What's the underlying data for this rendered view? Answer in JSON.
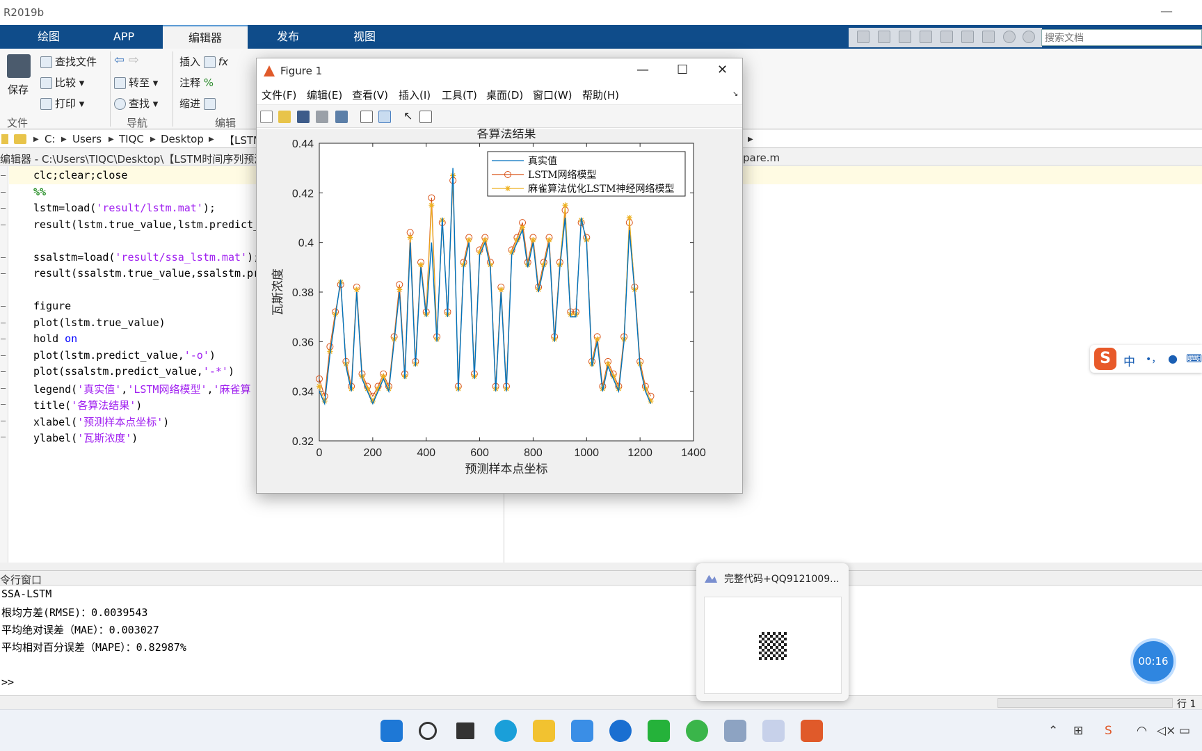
{
  "app": {
    "title": "R2019b",
    "minimize": "—"
  },
  "tabs": [
    "绘图",
    "APP",
    "编辑器",
    "发布",
    "视图"
  ],
  "search": {
    "placeholder": "搜索文档"
  },
  "ribbon": {
    "file": {
      "save": "保存",
      "find_files": "查找文件",
      "compare": "比较",
      "print": "打印",
      "section": "文件"
    },
    "nav": {
      "goto": "转至",
      "find": "查找",
      "section": "导航"
    },
    "edit": {
      "insert": "插入",
      "comment": "注释",
      "indent": "缩进",
      "fx": "fx",
      "section": "编辑"
    }
  },
  "breadcrumb": {
    "items": [
      "C:",
      "Users",
      "TIQC",
      "Desktop",
      "【LSTM"
    ]
  },
  "editor_header": {
    "path": "编辑器 - C:\\Users\\TIQC\\Desktop\\【LSTM时间序列预测",
    "tab2": "pare.m"
  },
  "code": [
    "clc;clear;close",
    "%%",
    "lstm=load('result/lstm.mat');",
    "result(lstm.true_value,lstm.predict_",
    "",
    "ssalstm=load('result/ssa_lstm.mat');",
    "result(ssalstm.true_value,ssalstm.pr",
    "",
    "figure",
    "plot(lstm.true_value)",
    "hold on",
    "plot(lstm.predict_value,'-o')",
    "plot(ssalstm.predict_value,'-*')",
    "legend('真实值','LSTM网络模型','麻雀算",
    "title('各算法结果')",
    "xlabel('预测样本点坐标')",
    "ylabel('瓦斯浓度')"
  ],
  "command_window": {
    "title": "令行窗口",
    "lines": [
      "SSA-LSTM",
      "根均方差(RMSE)：0.0039543",
      "平均绝对误差（MAE）：0.003027",
      "平均相对百分误差（MAPE）：0.82987%"
    ],
    "prompt": ">>"
  },
  "status": {
    "row": "行 1"
  },
  "figure": {
    "title": "Figure 1",
    "menu": [
      "文件(F)",
      "编辑(E)",
      "查看(V)",
      "插入(I)",
      "工具(T)",
      "桌面(D)",
      "窗口(W)",
      "帮助(H)"
    ]
  },
  "chart_data": {
    "type": "line",
    "title": "各算法结果",
    "xlabel": "预测样本点坐标",
    "ylabel": "瓦斯浓度",
    "xlim": [
      0,
      1400
    ],
    "ylim": [
      0.32,
      0.44
    ],
    "xticks": [
      0,
      200,
      400,
      600,
      800,
      1000,
      1200,
      1400
    ],
    "yticks": [
      0.32,
      0.34,
      0.36,
      0.38,
      0.4,
      0.42,
      0.44
    ],
    "legend_position": "top-right",
    "series": [
      {
        "name": "真实值",
        "color": "#0072bd",
        "marker": "none",
        "x": [
          0,
          20,
          40,
          60,
          80,
          100,
          120,
          140,
          160,
          180,
          200,
          220,
          240,
          260,
          280,
          300,
          320,
          340,
          360,
          380,
          400,
          420,
          440,
          460,
          480,
          500,
          520,
          540,
          560,
          580,
          600,
          620,
          640,
          660,
          680,
          700,
          720,
          740,
          760,
          780,
          800,
          820,
          840,
          860,
          880,
          900,
          920,
          940,
          960,
          980,
          1000,
          1020,
          1040,
          1060,
          1080,
          1100,
          1120,
          1140,
          1160,
          1180,
          1200,
          1220,
          1240
        ],
        "y": [
          0.34,
          0.335,
          0.355,
          0.37,
          0.385,
          0.35,
          0.34,
          0.38,
          0.345,
          0.34,
          0.335,
          0.34,
          0.345,
          0.34,
          0.36,
          0.38,
          0.345,
          0.4,
          0.35,
          0.39,
          0.37,
          0.4,
          0.36,
          0.41,
          0.37,
          0.43,
          0.34,
          0.39,
          0.4,
          0.345,
          0.395,
          0.4,
          0.39,
          0.34,
          0.38,
          0.34,
          0.395,
          0.4,
          0.405,
          0.39,
          0.4,
          0.38,
          0.39,
          0.4,
          0.36,
          0.39,
          0.41,
          0.37,
          0.37,
          0.41,
          0.4,
          0.35,
          0.36,
          0.34,
          0.35,
          0.345,
          0.34,
          0.36,
          0.405,
          0.38,
          0.35,
          0.34,
          0.335
        ]
      },
      {
        "name": "LSTM网络模型",
        "color": "#d95319",
        "marker": "o",
        "x": [
          0,
          20,
          40,
          60,
          80,
          100,
          120,
          140,
          160,
          180,
          200,
          220,
          240,
          260,
          280,
          300,
          320,
          340,
          360,
          380,
          400,
          420,
          440,
          460,
          480,
          500,
          520,
          540,
          560,
          580,
          600,
          620,
          640,
          660,
          680,
          700,
          720,
          740,
          760,
          780,
          800,
          820,
          840,
          860,
          880,
          900,
          920,
          940,
          960,
          980,
          1000,
          1020,
          1040,
          1060,
          1080,
          1100,
          1120,
          1140,
          1160,
          1180,
          1200,
          1220,
          1240
        ],
        "y": [
          0.345,
          0.338,
          0.358,
          0.372,
          0.383,
          0.352,
          0.342,
          0.382,
          0.347,
          0.342,
          0.338,
          0.342,
          0.347,
          0.342,
          0.362,
          0.383,
          0.347,
          0.404,
          0.352,
          0.392,
          0.372,
          0.418,
          0.362,
          0.408,
          0.372,
          0.425,
          0.342,
          0.392,
          0.402,
          0.347,
          0.397,
          0.402,
          0.392,
          0.342,
          0.382,
          0.342,
          0.397,
          0.402,
          0.408,
          0.392,
          0.402,
          0.382,
          0.392,
          0.402,
          0.362,
          0.392,
          0.413,
          0.372,
          0.372,
          0.408,
          0.402,
          0.352,
          0.362,
          0.342,
          0.352,
          0.347,
          0.342,
          0.362,
          0.408,
          0.382,
          0.352,
          0.342,
          0.338
        ]
      },
      {
        "name": "麻雀算法优化LSTM神经网络模型",
        "color": "#edb120",
        "marker": "*",
        "x": [
          0,
          20,
          40,
          60,
          80,
          100,
          120,
          140,
          160,
          180,
          200,
          220,
          240,
          260,
          280,
          300,
          320,
          340,
          360,
          380,
          400,
          420,
          440,
          460,
          480,
          500,
          520,
          540,
          560,
          580,
          600,
          620,
          640,
          660,
          680,
          700,
          720,
          740,
          760,
          780,
          800,
          820,
          840,
          860,
          880,
          900,
          920,
          940,
          960,
          980,
          1000,
          1020,
          1040,
          1060,
          1080,
          1100,
          1120,
          1140,
          1160,
          1180,
          1200,
          1220,
          1240
        ],
        "y": [
          0.342,
          0.336,
          0.356,
          0.371,
          0.384,
          0.351,
          0.341,
          0.381,
          0.346,
          0.341,
          0.336,
          0.341,
          0.346,
          0.341,
          0.361,
          0.381,
          0.346,
          0.402,
          0.351,
          0.391,
          0.371,
          0.415,
          0.361,
          0.409,
          0.371,
          0.427,
          0.341,
          0.391,
          0.401,
          0.346,
          0.396,
          0.401,
          0.391,
          0.341,
          0.381,
          0.341,
          0.396,
          0.401,
          0.406,
          0.391,
          0.401,
          0.381,
          0.391,
          0.401,
          0.361,
          0.391,
          0.415,
          0.371,
          0.371,
          0.409,
          0.401,
          0.351,
          0.361,
          0.341,
          0.351,
          0.346,
          0.341,
          0.361,
          0.41,
          0.381,
          0.351,
          0.341,
          0.336
        ]
      }
    ]
  },
  "ime": {
    "lang": "中",
    "punct": "•，"
  },
  "popup": {
    "title": "完整代码+QQ9121009..."
  },
  "timer": {
    "value": "00:16"
  }
}
